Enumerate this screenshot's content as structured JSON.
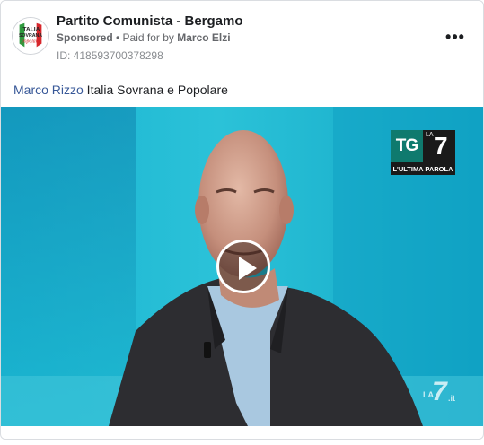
{
  "post": {
    "page_name": "Partito Comunista - Bergamo",
    "sponsored_label": "Sponsored",
    "paid_for_prefix": " • Paid for by ",
    "payer": "Marco Elzi",
    "ad_id": "ID: 418593700378298",
    "more_icon": "more-options-icon",
    "text_mention": "Marco Rizzo",
    "text_rest": " Italia Sovrana e Popolare"
  },
  "avatar": {
    "logo_line1": "ITALIA",
    "logo_line2": "SOVRANA",
    "logo_line3": "popolare",
    "colors": {
      "green": "#2e9a3e",
      "red": "#d7262b"
    }
  },
  "video": {
    "play_icon": "play-icon",
    "tg_left": "TG",
    "tg_la": "LA",
    "tg_num": "7",
    "tg_subtitle": "L'ULTIMA PAROLA",
    "watermark_la": "LA",
    "watermark_num": "7",
    "watermark_it": ".it"
  },
  "colors": {
    "mention": "#385898",
    "secondary_text": "#65676b",
    "video_bg": "#1fb6cf"
  }
}
